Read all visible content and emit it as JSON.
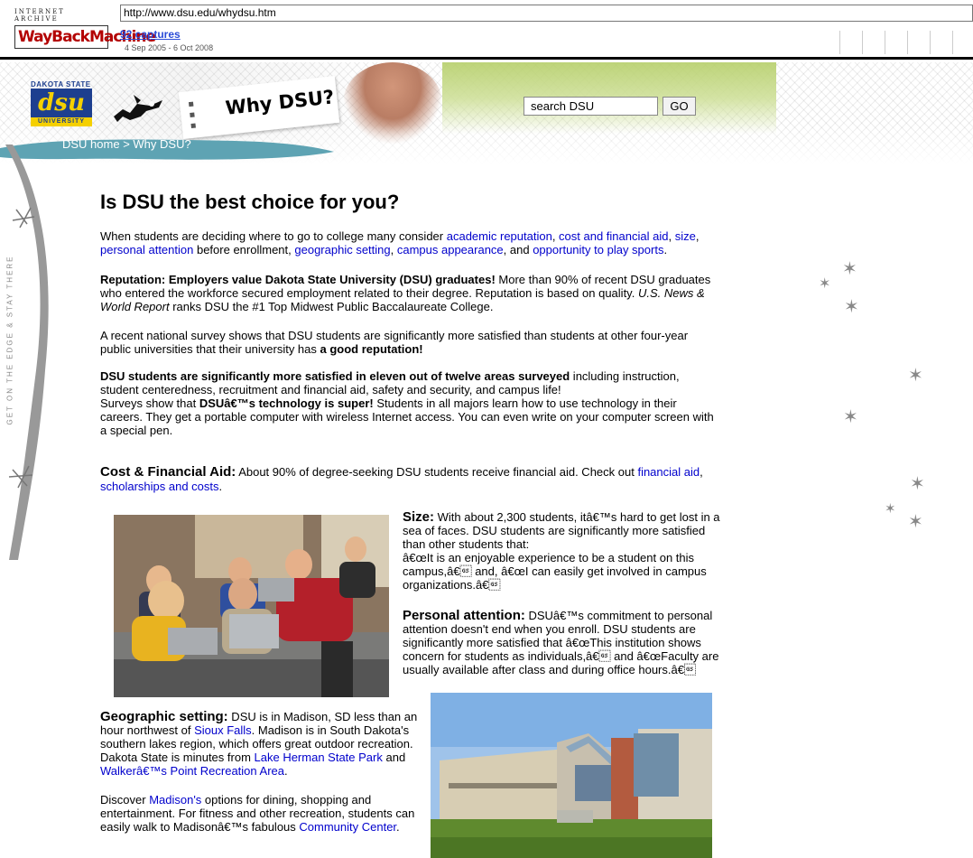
{
  "wayback": {
    "logo_top": "INTERNET ARCHIVE",
    "logo_main": "WayBackMachine",
    "url": "http://www.dsu.edu/whydsu.htm",
    "captures": "92 captures",
    "range": "4 Sep 2005 - 6 Oct 2008"
  },
  "header": {
    "logo_top": "DAKOTA STATE",
    "logo_main": "dsu",
    "logo_bottom": "UNIVERSITY",
    "page_tag": "Why DSU?",
    "search_value": "search DSU",
    "go_label": "GO",
    "breadcrumb": "DSU home > Why DSU?",
    "tagline": "GET ON THE EDGE & STAY THERE"
  },
  "content": {
    "title": "Is DSU the best choice for you?",
    "intro": {
      "p1": "When students are deciding where to go to college many consider ",
      "l1": "academic reputation",
      "s1": ", ",
      "l2": "cost and financial aid",
      "s2": ", ",
      "l3": "size",
      "s3": ",",
      "l4": "personal attention",
      "p2": " before enrollment, ",
      "l5": "geographic setting",
      "s4": ", ",
      "l6": "campus appearance",
      "p3": ", and ",
      "l7": "opportunity to play sports",
      "p4": "."
    },
    "reputation": {
      "bold": "Reputation: Employers value Dakota State University (DSU) graduates!",
      "t1": " More than 90% of recent DSU graduates who entered the workforce secured employment related to their degree. Reputation is based on quality. ",
      "italic": "U.S. News & World Report",
      "t2": " ranks DSU the #1 Top Midwest Public Baccalaureate College."
    },
    "survey": {
      "t1": "A recent national survey shows that DSU students are significantly more satisfied than students at other four-year public universities that their university has ",
      "bold": "a good reputation!"
    },
    "satisfied": {
      "bold": "DSU students are significantly more satisfied in eleven out of twelve areas surveyed",
      "t1": " including instruction, student centeredness, recruitment and financial aid, safety and security, and campus life!",
      "t2": "Surveys show that ",
      "bold2": "DSUâ€™s technology is super!",
      "t3": " Students in all majors learn how to use technology in their careers. They get a portable computer with wireless Internet access. You can even write on your computer screen with a special pen."
    },
    "cost": {
      "heading": "Cost & Financial Aid:",
      "t1": " About 90% of degree-seeking DSU students receive financial aid. Check out ",
      "l1": "financial aid",
      "s1": ",",
      "l2": "scholarships and costs",
      "t2": "."
    },
    "size": {
      "heading": "Size:",
      "t1": " With about 2,300 students, itâ€™s hard to get lost in a sea of faces. DSU students are significantly more satisfied than other students that:",
      "t2": "â€œIt is an enjoyable experience to be a student on this campus,â€\u001d and, â€œI can easily get involved in campus organizations.â€\u001d"
    },
    "personal": {
      "heading": "Personal attention:",
      "t1": " DSUâ€™s commitment to personal attention doesn't end when you enroll. DSU students are significantly more satisfied that â€œThis institution shows concern for students as individuals,â€\u001d and â€œFaculty are usually available after class and during office hours.â€\u001d"
    },
    "geo": {
      "heading": "Geographic setting:",
      "t1": " DSU is in Madison, SD less than an hour northwest of ",
      "l1": "Sioux Falls",
      "t2": ". Madison is in South Dakota's southern lakes region, which offers great outdoor recreation. Dakota State is minutes from ",
      "l2": "Lake Herman State Park",
      "t3": " and ",
      "l3": "Walkerâ€™s Point Recreation Area",
      "t4": "."
    },
    "discover": {
      "t1": "Discover ",
      "l1": "Madison's",
      "t2": " options for dining, shopping and entertainment. For fitness and other recreation, students can easily walk to Madisonâ€™s fabulous ",
      "l2": "Community Center",
      "t3": "."
    }
  }
}
